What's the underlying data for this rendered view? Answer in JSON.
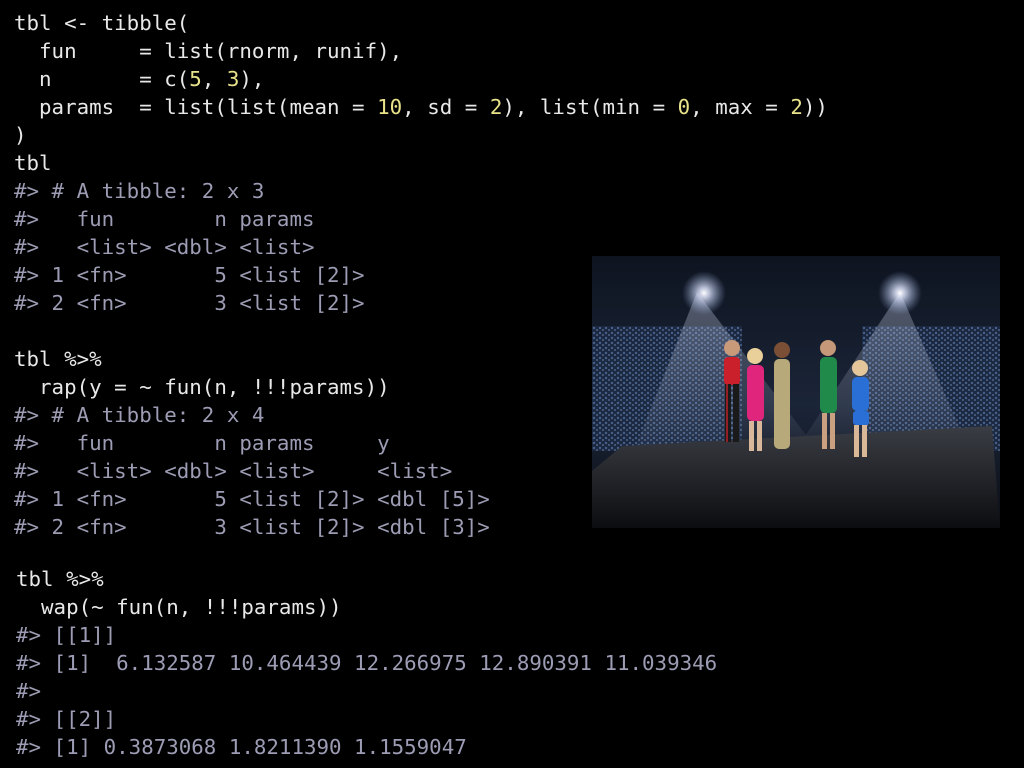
{
  "blocks": [
    {
      "lines": [
        {
          "kind": "code",
          "segments": [
            {
              "t": "tbl <- tibble("
            }
          ]
        },
        {
          "kind": "code",
          "segments": [
            {
              "t": "  fun     = list(rnorm, runif),"
            }
          ]
        },
        {
          "kind": "code",
          "segments": [
            {
              "t": "  n       = c("
            },
            {
              "t": "5",
              "num": true
            },
            {
              "t": ", "
            },
            {
              "t": "3",
              "num": true
            },
            {
              "t": "),"
            }
          ]
        },
        {
          "kind": "code",
          "segments": [
            {
              "t": "  params  = list(list(mean = "
            },
            {
              "t": "10",
              "num": true
            },
            {
              "t": ", sd = "
            },
            {
              "t": "2",
              "num": true
            },
            {
              "t": "), list(min = "
            },
            {
              "t": "0",
              "num": true
            },
            {
              "t": ", max = "
            },
            {
              "t": "2",
              "num": true
            },
            {
              "t": "))"
            }
          ]
        },
        {
          "kind": "code",
          "segments": [
            {
              "t": ")"
            }
          ]
        },
        {
          "kind": "code",
          "segments": [
            {
              "t": "tbl"
            }
          ]
        },
        {
          "kind": "out",
          "segments": [
            {
              "t": "#> # A tibble: 2 x 3"
            }
          ]
        },
        {
          "kind": "out",
          "segments": [
            {
              "t": "#>   fun        n params"
            }
          ]
        },
        {
          "kind": "out",
          "segments": [
            {
              "t": "#>   <list> <dbl> <list>"
            }
          ]
        },
        {
          "kind": "out",
          "segments": [
            {
              "t": "#> 1 <fn>       5 <list [2]>"
            }
          ]
        },
        {
          "kind": "out",
          "segments": [
            {
              "t": "#> 2 <fn>       3 <list [2]>"
            }
          ]
        }
      ]
    },
    {
      "lines": [
        {
          "kind": "code",
          "segments": [
            {
              "t": "tbl %>%"
            }
          ]
        },
        {
          "kind": "code",
          "segments": [
            {
              "t": "  rap(y = ~ fun(n, !!!params))"
            }
          ]
        },
        {
          "kind": "out",
          "segments": [
            {
              "t": "#> # A tibble: 2 x 4"
            }
          ]
        },
        {
          "kind": "out",
          "segments": [
            {
              "t": "#>   fun        n params     y"
            }
          ]
        },
        {
          "kind": "out",
          "segments": [
            {
              "t": "#>   <list> <dbl> <list>     <list>"
            }
          ]
        },
        {
          "kind": "out",
          "segments": [
            {
              "t": "#> 1 <fn>       5 <list [2]> <dbl [5]>"
            }
          ]
        },
        {
          "kind": "out",
          "segments": [
            {
              "t": "#> 2 <fn>       3 <list [2]> <dbl [3]>"
            }
          ]
        }
      ]
    },
    {
      "lines": [
        {
          "kind": "code",
          "segments": [
            {
              "t": "tbl %>%"
            }
          ]
        },
        {
          "kind": "code",
          "segments": [
            {
              "t": "  wap(~ fun(n, !!!params))"
            }
          ]
        },
        {
          "kind": "out",
          "segments": [
            {
              "t": "#> [[1]]"
            }
          ]
        },
        {
          "kind": "out",
          "segments": [
            {
              "t": "#> [1]  6.132587 10.464439 12.266975 12.890391 11.039346"
            }
          ]
        },
        {
          "kind": "out",
          "segments": [
            {
              "t": "#>"
            }
          ]
        },
        {
          "kind": "out",
          "segments": [
            {
              "t": "#> [[2]]"
            }
          ]
        },
        {
          "kind": "out",
          "segments": [
            {
              "t": "#> [1] 0.3873068 1.8211390 1.1559047"
            }
          ]
        }
      ]
    }
  ],
  "photo": {
    "subject": "five performers on a stage under spotlights, arena crowd in the background",
    "colors": {
      "background": "#000000",
      "code": "#e8e8e8",
      "output": "#9c9cb4",
      "number": "#e8e38a"
    }
  }
}
